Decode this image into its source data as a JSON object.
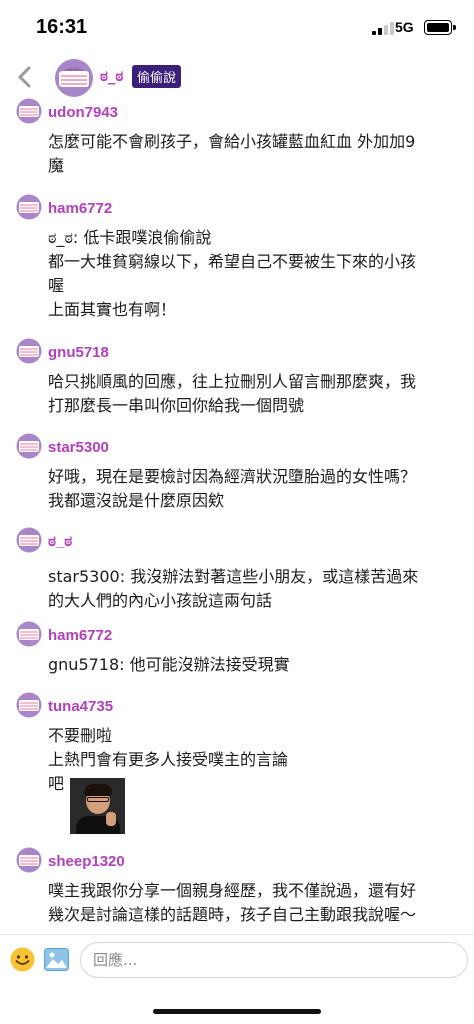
{
  "status": {
    "time": "16:31",
    "network": "5G"
  },
  "header": {
    "poster": "ಠ_ಠ",
    "badge": "偷偷說"
  },
  "comments": [
    {
      "user": "udon7943",
      "lines": [
        "怎麼可能不會刷孩子，會給小孩罐藍血紅血 外加加9",
        "魔"
      ]
    },
    {
      "user": "ham6772",
      "lines": [
        "ಠ_ಠ: 低卡跟噗浪偷偷說",
        "都一大堆貧窮線以下，希望自己不要被生下來的小孩",
        "喔",
        "上面其實也有啊！"
      ]
    },
    {
      "user": "gnu5718",
      "lines": [
        "哈只挑順風的回應，往上拉刪別人留言刪那麼爽，我",
        "打那麼長一串叫你回你給我一個問號"
      ]
    },
    {
      "user": "star5300",
      "lines": [
        "好哦，現在是要檢討因為經濟狀況墮胎過的女性嗎？",
        "我都還沒說是什麼原因欸"
      ]
    },
    {
      "user": "ಠ_ಠ",
      "lines": [
        "star5300: 我沒辦法對著這些小朋友，或這樣苦過來",
        "的大人們的內心小孩說這兩句話"
      ]
    },
    {
      "user": "ham6772",
      "lines": [
        "gnu5718: 他可能沒辦法接受現實"
      ]
    },
    {
      "user": "tuna4735",
      "lines": [
        "不要刪啦",
        "上熱門會有更多人接受噗主的言論",
        "吧"
      ]
    },
    {
      "user": "sheep1320",
      "lines": [
        "噗主我跟你分享一個親身經歷，我不僅說過，還有好",
        "幾次是討論這樣的話題時，孩子自己主動跟我說喔～"
      ]
    }
  ],
  "composer": {
    "placeholder": "回應..."
  },
  "colors": {
    "username": "#b33fbf",
    "badge_bg": "#3b1f7a",
    "avatar_purple": "#a985c9",
    "avatar_pink": "#f2a7c3"
  }
}
